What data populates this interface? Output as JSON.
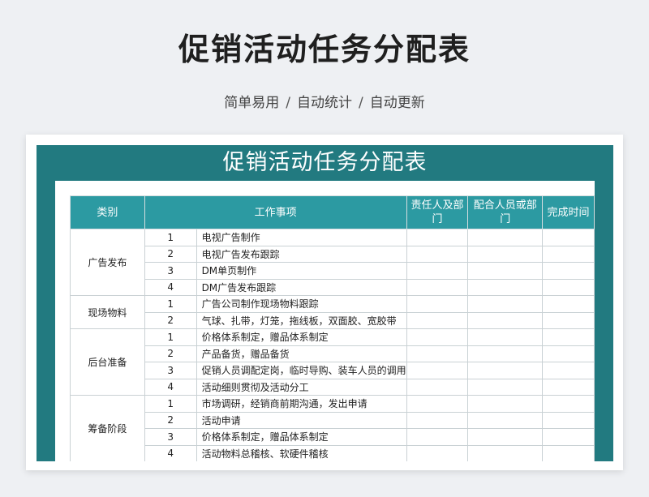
{
  "page": {
    "title": "促销活动任务分配表",
    "subtitle": [
      "简单易用",
      "自动统计",
      "自动更新"
    ],
    "subtitle_separator": "/"
  },
  "sheet": {
    "title": "促销活动任务分配表",
    "header_color": "#2c9aa2",
    "frame_color": "#227a80",
    "columns": [
      "类别",
      "工作事项",
      "责任人及部门",
      "配合人员或部门",
      "完成时间"
    ],
    "groups": [
      {
        "category": "广告发布",
        "tasks": [
          {
            "no": "1",
            "item": "电视广告制作"
          },
          {
            "no": "2",
            "item": "电视广告发布跟踪"
          },
          {
            "no": "3",
            "item": "DM单页制作"
          },
          {
            "no": "4",
            "item": "DM广告发布跟踪"
          }
        ]
      },
      {
        "category": "现场物料",
        "tasks": [
          {
            "no": "1",
            "item": "广告公司制作现场物料跟踪"
          },
          {
            "no": "2",
            "item": "气球、扎带，灯笼，拖线板，双面胶、宽胶带"
          }
        ]
      },
      {
        "category": "后台准备",
        "tasks": [
          {
            "no": "1",
            "item": "价格体系制定，赠品体系制定"
          },
          {
            "no": "2",
            "item": "产品备货，赠品备货"
          },
          {
            "no": "3",
            "item": "促销人员调配定岗，临时导购、装车人员的调用"
          },
          {
            "no": "4",
            "item": "活动细则贯彻及活动分工"
          }
        ]
      },
      {
        "category": "筹备阶段",
        "tasks": [
          {
            "no": "1",
            "item": "市场调研，经销商前期沟通，发出申请"
          },
          {
            "no": "2",
            "item": "活动申请"
          },
          {
            "no": "3",
            "item": "价格体系制定，赠品体系制定"
          },
          {
            "no": "4",
            "item": "活动物料总稽核、软硬件稽核"
          }
        ]
      }
    ]
  }
}
